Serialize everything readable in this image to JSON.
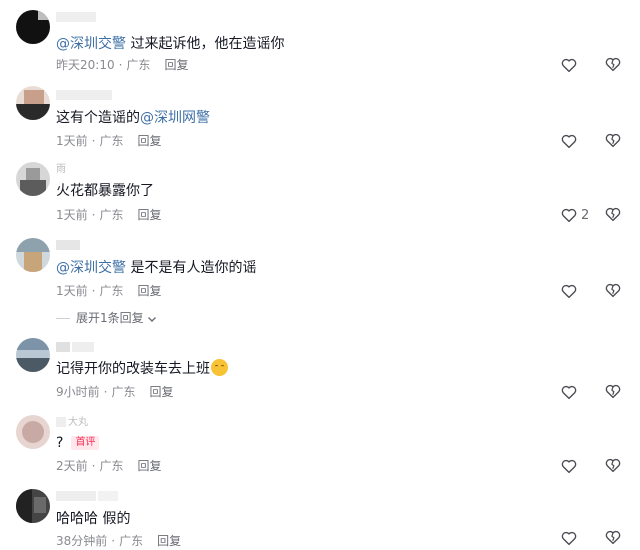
{
  "comments": [
    {
      "name": "",
      "mention": "@深圳交警",
      "text": " 过来起诉他，他在造谣你",
      "time": "昨天20:10",
      "location": "广东",
      "reply": "回复",
      "likes": ""
    },
    {
      "name": "",
      "mention": "",
      "text": "这有个造谣的",
      "mention_after": "@深圳网警",
      "time": "1天前",
      "location": "广东",
      "reply": "回复",
      "likes": ""
    },
    {
      "name": "雨",
      "mention": "",
      "text": "火花都暴露你了",
      "time": "1天前",
      "location": "广东",
      "reply": "回复",
      "likes": "2"
    },
    {
      "name": "",
      "mention": "@深圳交警",
      "text": " 是不是有人造你的谣",
      "time": "1天前",
      "location": "广东",
      "reply": "回复",
      "likes": ""
    },
    {
      "name": "",
      "mention": "",
      "text": "记得开你的改装车去上班",
      "time": "9小时前",
      "location": "广东",
      "reply": "回复",
      "likes": ""
    },
    {
      "name": "大丸",
      "mention": "",
      "text": "?",
      "tag": "首评",
      "time": "2天前",
      "location": "广东",
      "reply": "回复",
      "likes": ""
    },
    {
      "name": "",
      "mention": "",
      "text": "哈哈哈 假的",
      "time": "38分钟前",
      "location": "广东",
      "reply": "回复",
      "likes": ""
    }
  ],
  "expand_replies": "展开1条回复",
  "icons": {
    "like": "heart-outline-icon",
    "dislike": "broken-heart-icon",
    "expand": "chevron-down-icon"
  },
  "colors": {
    "mention": "#3d6fa6",
    "tag_text": "#fe2c55",
    "meta": "#8a8b91"
  }
}
